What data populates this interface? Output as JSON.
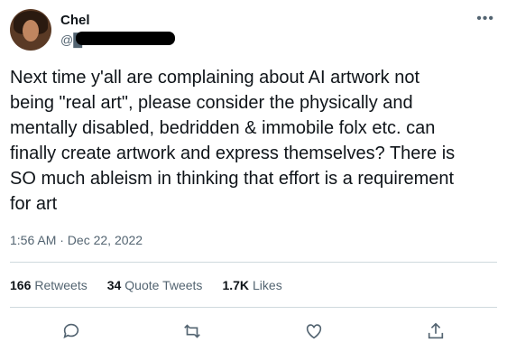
{
  "author": {
    "name": "Chel",
    "handle": "@█"
  },
  "more_icon": "more-horizontal-icon",
  "tweet": {
    "text": "Next time y'all are complaining about AI artwork not\nbeing \"real art\", please consider the physically and\nmentally disabled, bedridden & immobile folx etc. can\nfinally create artwork and express themselves? There is\nSO much ableism in thinking that effort is a requirement\nfor art",
    "timestamp": "1:56 AM · Dec 22, 2022"
  },
  "stats": {
    "retweets_count": "166",
    "retweets_label": "Retweets",
    "quotes_count": "34",
    "quotes_label": "Quote Tweets",
    "likes_count": "1.7K",
    "likes_label": "Likes"
  },
  "actions": [
    "reply-icon",
    "retweet-icon",
    "like-icon",
    "share-icon"
  ]
}
